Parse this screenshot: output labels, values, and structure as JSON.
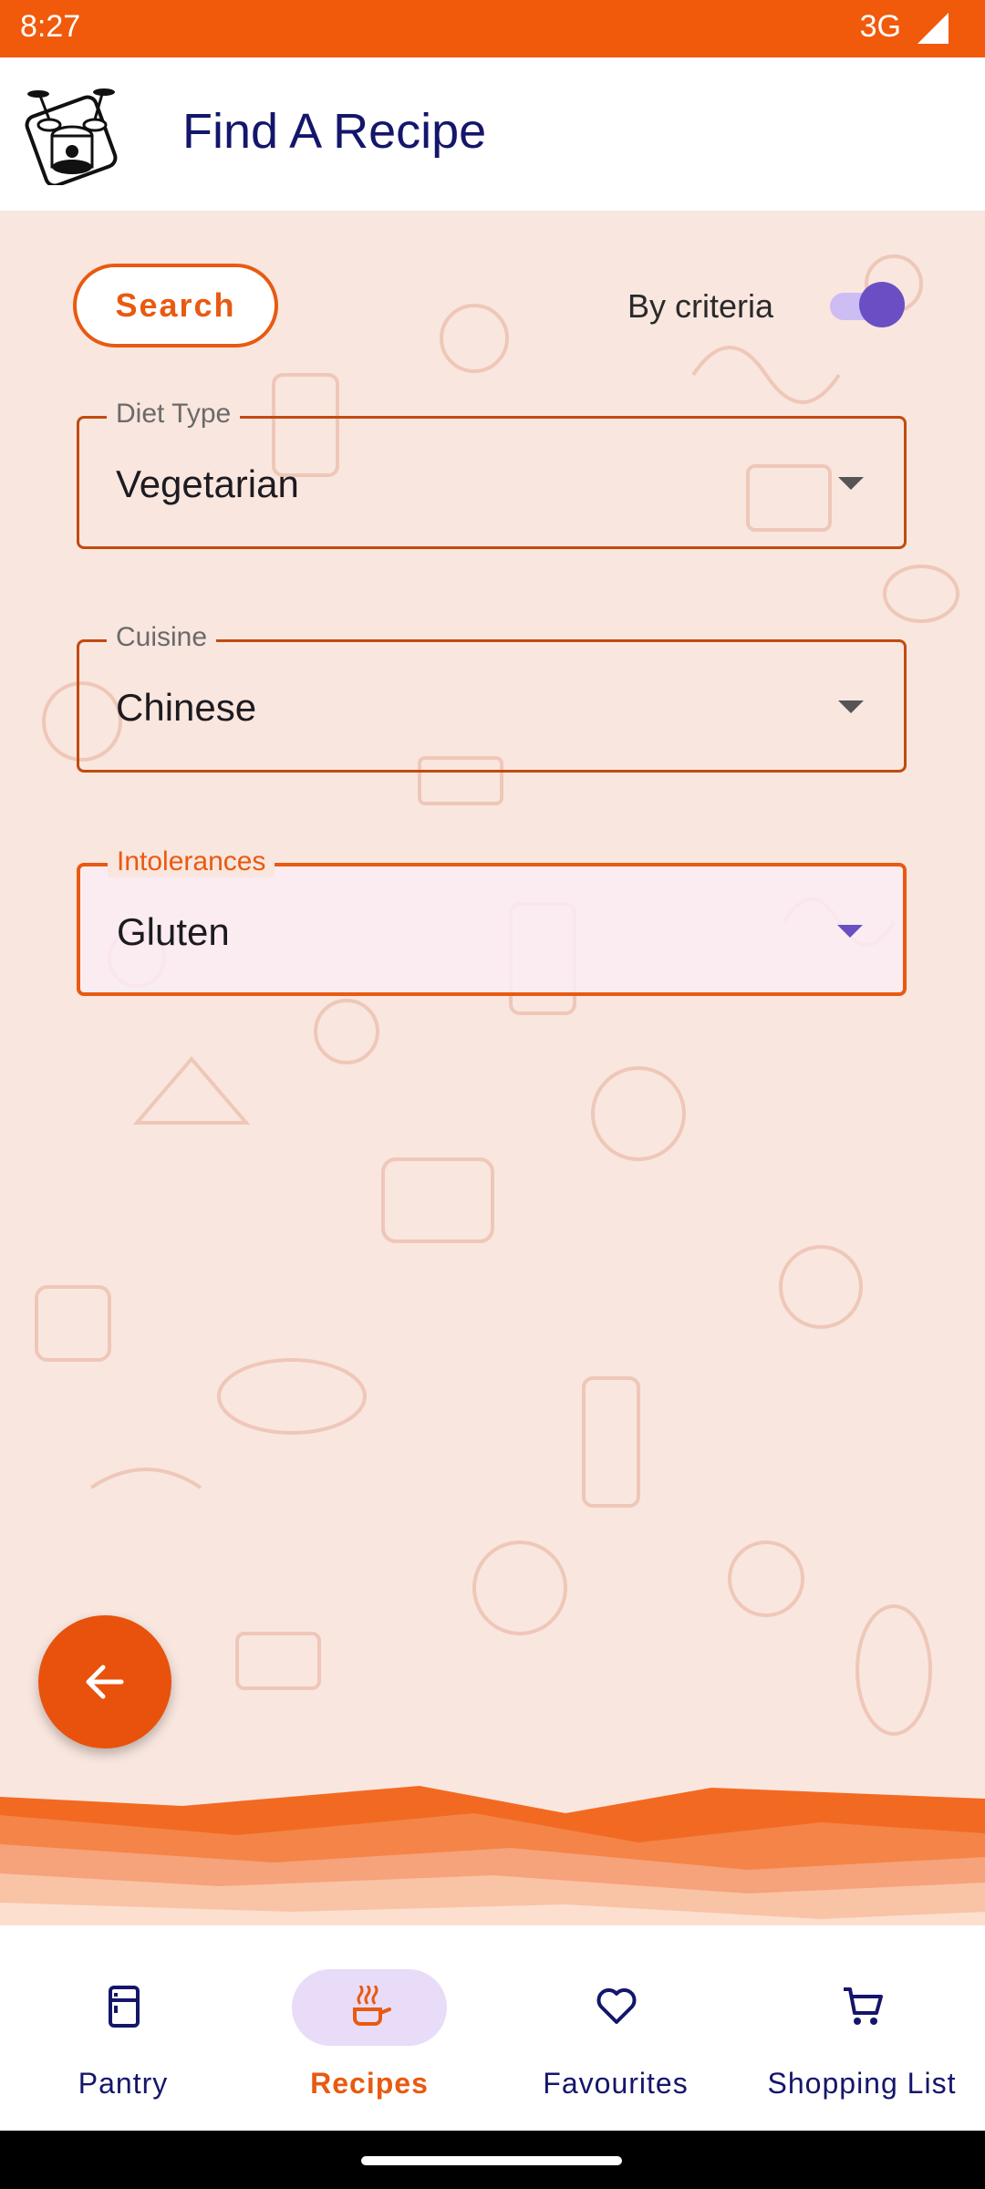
{
  "status_bar": {
    "time": "8:27",
    "network": "3G"
  },
  "app_bar": {
    "title": "Find A Recipe",
    "logo_icon": "drum-set-phone-logo"
  },
  "search": {
    "button_label": "Search",
    "criteria_label": "By criteria",
    "criteria_toggle_on": true
  },
  "filters": [
    {
      "label": "Diet Type",
      "value": "Vegetarian",
      "active": false
    },
    {
      "label": "Cuisine",
      "value": "Chinese",
      "active": false
    },
    {
      "label": "Intolerances",
      "value": "Gluten",
      "active": true
    }
  ],
  "fab": {
    "icon": "arrow-left-icon"
  },
  "bottom_nav": [
    {
      "label": "Pantry",
      "icon": "fridge-icon",
      "active": false
    },
    {
      "label": "Recipes",
      "icon": "cooking-pot-icon",
      "active": true
    },
    {
      "label": "Favourites",
      "icon": "heart-icon",
      "active": false
    },
    {
      "label": "Shopping List",
      "icon": "cart-icon",
      "active": false
    }
  ],
  "colors": {
    "brand_orange": "#f15a0b",
    "accent_purple": "#6a4fc4",
    "title_navy": "#14166b",
    "background_tint": "#f9e6df"
  }
}
